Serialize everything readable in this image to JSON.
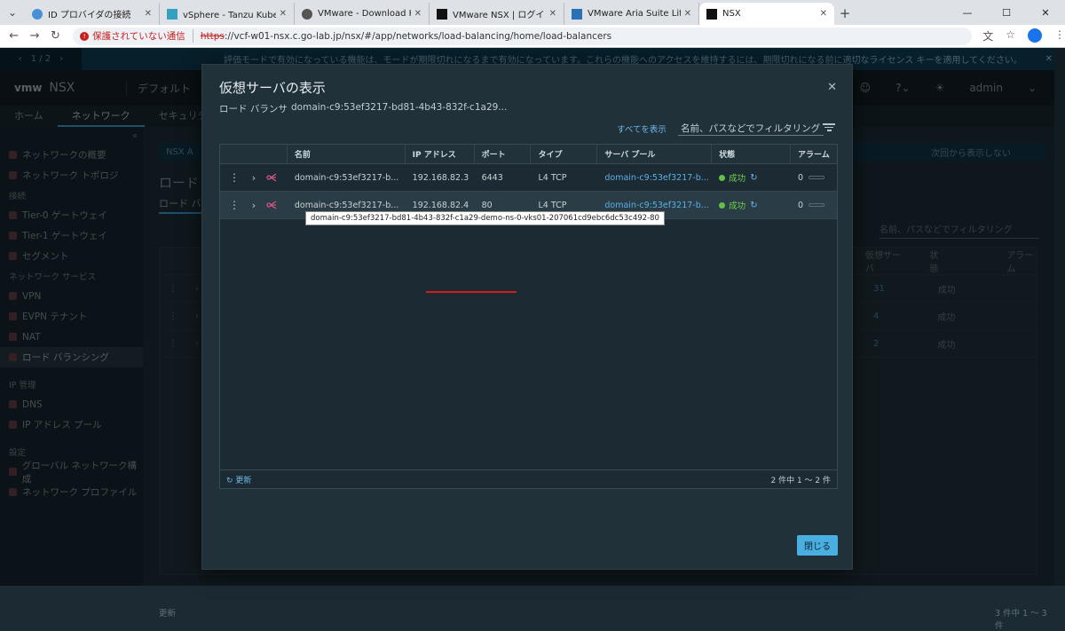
{
  "browser": {
    "tabs": [
      {
        "title": "ID プロバイダの接続",
        "fav": "#4a90d9"
      },
      {
        "title": "vSphere - Tanzu Kubernetes ク",
        "fav": "#35a0c0"
      },
      {
        "title": "VMware - Download Kubernete",
        "fav": "#555555"
      },
      {
        "title": "VMware NSX | ログイン",
        "fav": "#111111"
      },
      {
        "title": "VMware Aria Suite Lifecycle",
        "fav": "#2b6fb6"
      },
      {
        "title": "NSX",
        "fav": "#111111"
      }
    ],
    "security_label": "保護されていない通信",
    "url_scheme": "https",
    "url_rest": "://vcf-w01-nsx.c.go-lab.jp/nsx/#/app/networks/load-balancing/home/load-balancers"
  },
  "banner": {
    "pager": "1 / 2",
    "message": "評価モードで有効になっている機能は、モードが期限切れになるまで有効になっています。これらの機能へのアクセスを維持するには、期限切れになる前に適切なライセンス キーを適用してください。"
  },
  "header": {
    "logo": "vmw",
    "product": "NSX",
    "context": "デフォルト",
    "user": "admin"
  },
  "topnav": [
    "ホーム",
    "ネットワーク",
    "セキュリティ"
  ],
  "sidebar": {
    "items": [
      {
        "label": "ネットワークの概要",
        "type": "item"
      },
      {
        "label": "ネットワーク トポロジ",
        "type": "item"
      },
      {
        "label": "接続",
        "type": "section"
      },
      {
        "label": "Tier-0 ゲートウェイ",
        "type": "item"
      },
      {
        "label": "Tier-1 ゲートウェイ",
        "type": "item"
      },
      {
        "label": "セグメント",
        "type": "item"
      },
      {
        "label": "ネットワーク サービス",
        "type": "section"
      },
      {
        "label": "VPN",
        "type": "item"
      },
      {
        "label": "EVPN テナント",
        "type": "item"
      },
      {
        "label": "NAT",
        "type": "item"
      },
      {
        "label": "ロード バランシング",
        "type": "item",
        "active": true
      },
      {
        "label": "IP 管理",
        "type": "section"
      },
      {
        "label": "DNS",
        "type": "item"
      },
      {
        "label": "IP アドレス プール",
        "type": "item"
      },
      {
        "label": "設定",
        "type": "section"
      },
      {
        "label": "グローバル ネットワーク構成",
        "type": "item"
      },
      {
        "label": "ネットワーク プロファイル",
        "type": "item"
      }
    ]
  },
  "background": {
    "info": "NSX A",
    "title": "ロード",
    "tab": "ロード バラ",
    "filter_placeholder": "名前、パスなどでフィルタリング",
    "hide_text": "次回から表示しない",
    "columns": [
      "仮想サーバ",
      "状態",
      "アラーム"
    ],
    "rows": [
      {
        "count": "31",
        "status": "成功"
      },
      {
        "count": "4",
        "status": "成功"
      },
      {
        "count": "2",
        "status": "成功"
      }
    ],
    "footer_refresh": "更新",
    "footer_count": "3 件中 1 ～ 3 件"
  },
  "modal": {
    "title": "仮想サーバの表示",
    "lb_label": "ロード バランサ",
    "lb_value": "domain-c9:53ef3217-bd81-4b43-832f-c1a29...",
    "show_all": "すべてを表示",
    "filter_placeholder": "名前、パスなどでフィルタリング",
    "columns": [
      "名前",
      "IP アドレス",
      "ポート",
      "タイプ",
      "サーバ プール",
      "状態",
      "アラーム"
    ],
    "rows": [
      {
        "name": "domain-c9:53ef3217-b...",
        "ip": "192.168.82.3",
        "port": "6443",
        "type": "L4 TCP",
        "pool": "domain-c9:53ef3217-b...",
        "status": "成功",
        "alarms": "0"
      },
      {
        "name": "domain-c9:53ef3217-b...",
        "ip": "192.168.82.4",
        "port": "80",
        "type": "L4 TCP",
        "pool": "domain-c9:53ef3217-b...",
        "status": "成功",
        "alarms": "0"
      }
    ],
    "tooltip": "domain-c9:53ef3217-bd81-4b43-832f-c1a29-demo-ns-0-vks01-207061cd9ebc6dc53c492-80",
    "refresh": "更新",
    "count": "2 件中 1 ～ 2 件",
    "close": "閉じる"
  },
  "colors": {
    "accent": "#49aee0",
    "success": "#62c046",
    "highlight_underline": "#d81b1b"
  }
}
